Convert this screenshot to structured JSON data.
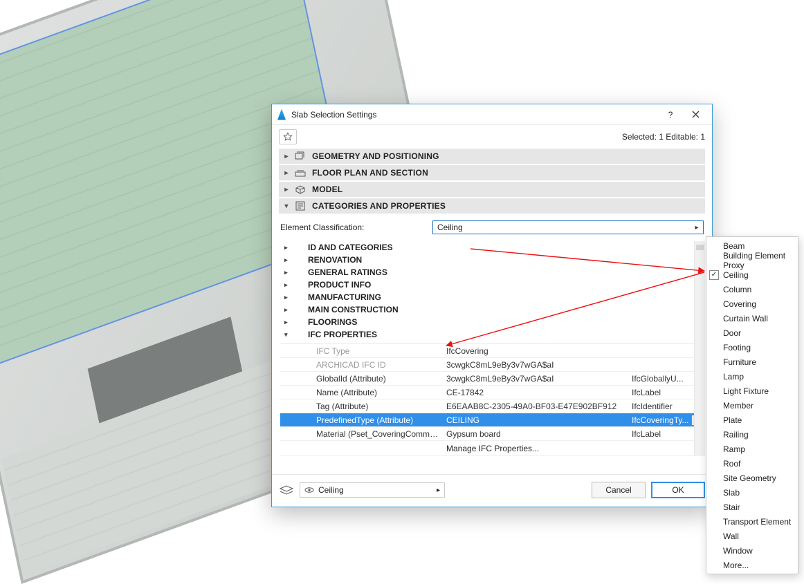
{
  "dialog": {
    "title": "Slab Selection Settings",
    "status": "Selected: 1 Editable: 1",
    "help_hint": "?",
    "sections": {
      "s1": "GEOMETRY AND POSITIONING",
      "s2": "FLOOR PLAN AND SECTION",
      "s3": "MODEL",
      "s4": "CATEGORIES AND PROPERTIES"
    },
    "classification_label": "Element Classification:",
    "classification_value": "Ceiling",
    "tree": {
      "t1": "ID AND CATEGORIES",
      "t2": "RENOVATION",
      "t3": "GENERAL RATINGS",
      "t4": "PRODUCT INFO",
      "t5": "MANUFACTURING",
      "t6": "MAIN CONSTRUCTION",
      "t7": "FLOORINGS",
      "t8": "IFC PROPERTIES"
    },
    "ifc_rows": [
      {
        "k": "IFC Type",
        "v": "IfcCovering",
        "t": "",
        "dim": true
      },
      {
        "k": "ARCHICAD IFC ID",
        "v": "3cwgkC8mL9eBy3v7wGA$aI",
        "t": "",
        "dim": true
      },
      {
        "k": "GlobalId (Attribute)",
        "v": "3cwgkC8mL9eBy3v7wGA$aI",
        "t": "IfcGloballyU..."
      },
      {
        "k": "Name (Attribute)",
        "v": "CE-17842",
        "t": "IfcLabel"
      },
      {
        "k": "Tag (Attribute)",
        "v": "E6EAAB8C-2305-49A0-BF03-E47E902BF912",
        "t": "IfcIdentifier"
      },
      {
        "k": "PredefinedType (Attribute)",
        "v": "CEILING",
        "t": "IfcCoveringTy...",
        "selected": true
      },
      {
        "k": "Material (Pset_CoveringCommon)",
        "v": "Gypsum board",
        "t": "IfcLabel"
      }
    ],
    "manage_label": "Manage IFC Properties...",
    "layer_value": "Ceiling",
    "cancel": "Cancel",
    "ok": "OK"
  },
  "popup_items": [
    {
      "label": "Beam"
    },
    {
      "label": "Building Element Proxy"
    },
    {
      "label": "Ceiling",
      "checked": true
    },
    {
      "label": "Column"
    },
    {
      "label": "Covering"
    },
    {
      "label": "Curtain Wall"
    },
    {
      "label": "Door"
    },
    {
      "label": "Footing"
    },
    {
      "label": "Furniture"
    },
    {
      "label": "Lamp"
    },
    {
      "label": "Light Fixture"
    },
    {
      "label": "Member"
    },
    {
      "label": "Plate"
    },
    {
      "label": "Railing"
    },
    {
      "label": "Ramp"
    },
    {
      "label": "Roof"
    },
    {
      "label": "Site Geometry"
    },
    {
      "label": "Slab"
    },
    {
      "label": "Stair"
    },
    {
      "label": "Transport Element"
    },
    {
      "label": "Wall"
    },
    {
      "label": "Window"
    },
    {
      "label": "More..."
    }
  ]
}
